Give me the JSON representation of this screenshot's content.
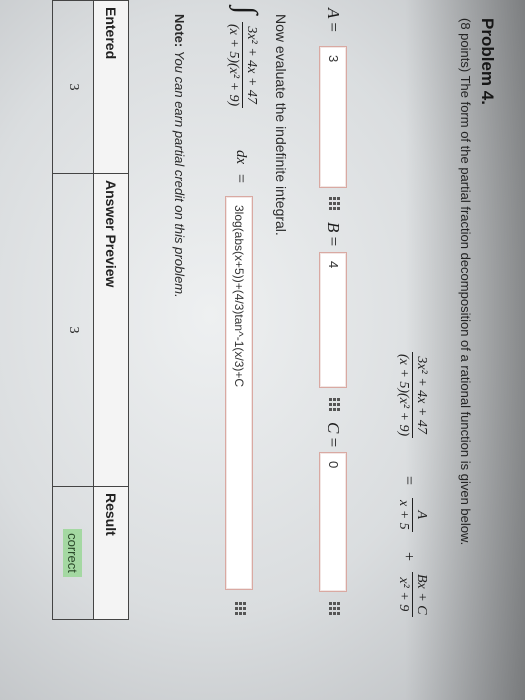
{
  "problem": {
    "title": "Problem 4.",
    "description": "(8 points) The form of the partial fraction decomposition of a rational function is given below."
  },
  "equation": {
    "lhs_numerator": "3x² + 4x + 47",
    "lhs_denominator": "(x + 5)(x² + 9)",
    "equals": "=",
    "term1_numerator": "A",
    "term1_denominator": "x + 5",
    "plus": "+",
    "term2_numerator": "Bx + C",
    "term2_denominator": "x² + 9"
  },
  "coefficients": {
    "a_label": "A",
    "a_value": "3",
    "b_label": "B",
    "b_value": "4",
    "c_label": "C",
    "c_value": "0",
    "equals": "="
  },
  "integral": {
    "prompt": "Now evaluate the indefinite integral.",
    "integral_sign": "∫",
    "numerator": "3x² + 4x + 47",
    "denominator": "(x + 5)(x² + 9)",
    "dx": "dx",
    "equals": "=",
    "answer_value": "3log(abs(x+5))+(4/3)tan^-1(x/3)+C"
  },
  "note": {
    "label": "Note:",
    "text": " You can earn partial credit on this problem."
  },
  "results": {
    "headers": [
      "Entered",
      "Answer Preview",
      "Result"
    ],
    "rows": [
      {
        "entered": "3",
        "preview": "3",
        "result": "correct"
      }
    ]
  },
  "colors": {
    "input_border": "#d9a9a2",
    "correct_bg": "#a4d8a2"
  }
}
